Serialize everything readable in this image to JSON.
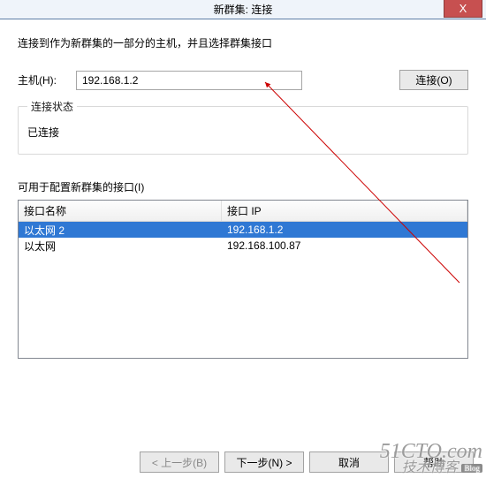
{
  "titlebar": {
    "title": "新群集: 连接",
    "close_glyph": "X"
  },
  "instruction": "连接到作为新群集的一部分的主机，并且选择群集接口",
  "host": {
    "label": "主机(H):",
    "value": "192.168.1.2",
    "connect_btn": "连接(O)"
  },
  "status_box": {
    "legend": "连接状态",
    "text": "已连接"
  },
  "interfaces": {
    "label": "可用于配置新群集的接口(I)",
    "columns": {
      "name": "接口名称",
      "ip": "接口 IP"
    },
    "rows": [
      {
        "name": "以太网 2",
        "ip": "192.168.1.2",
        "selected": true
      },
      {
        "name": "以太网",
        "ip": "192.168.100.87",
        "selected": false
      }
    ]
  },
  "footer": {
    "back": "< 上一步(B)",
    "next": "下一步(N) >",
    "cancel": "取消",
    "help": "帮助"
  },
  "watermark": {
    "line1": "51CTO.com",
    "line2": "技术博客",
    "tag": "Blog"
  }
}
